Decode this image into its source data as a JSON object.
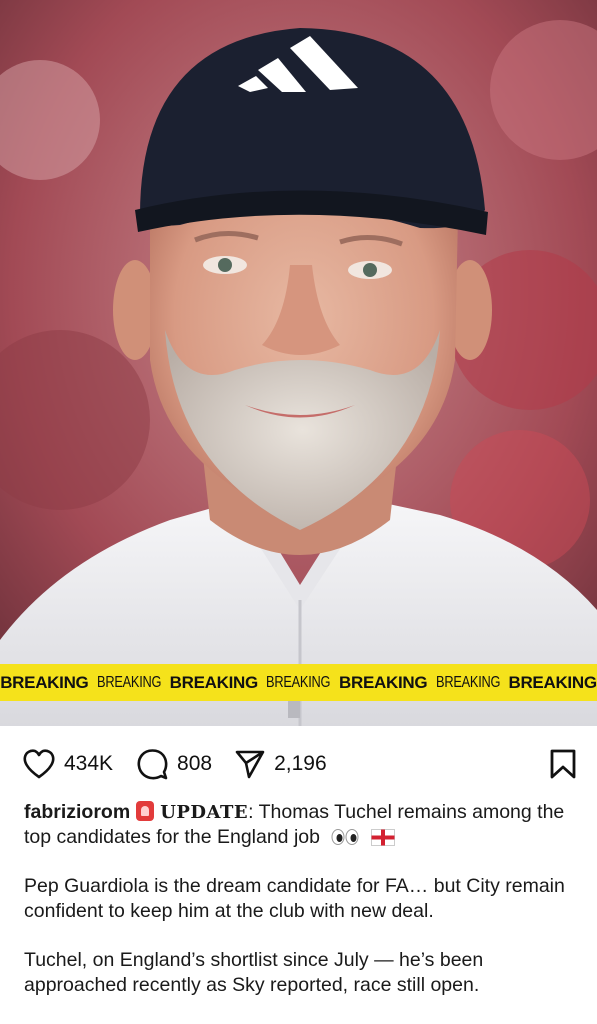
{
  "post": {
    "breaking_words": [
      "BREAKING",
      "BREAKING",
      "BREAKING",
      "BREAKING",
      "BREAKING",
      "BREAKING",
      "BREAKING"
    ],
    "likes": "434K",
    "comments": "808",
    "shares": "2,196"
  },
  "caption": {
    "username": "fabriziorom",
    "update_label": "UPDATE",
    "line1": ": Thomas Tuchel remains among the top candidates for the England job",
    "paragraph2": "Pep Guardiola is the dream candidate for FA… but City remain confident to keep him at the club with new deal.",
    "paragraph3": "Tuchel, on England’s shortlist since July — he’s been approached recently as Sky reported, race still open."
  },
  "icons": {
    "like": "heart-icon",
    "comment": "speech-bubble-icon",
    "share": "paper-plane-icon",
    "save": "bookmark-icon",
    "siren": "siren-emoji-icon",
    "eyes": "eyes-emoji-icon",
    "flag": "england-flag-icon"
  },
  "colors": {
    "banner_yellow": "#f5e21b",
    "cap_navy": "#1b2030",
    "background_red": "#a8333d"
  }
}
